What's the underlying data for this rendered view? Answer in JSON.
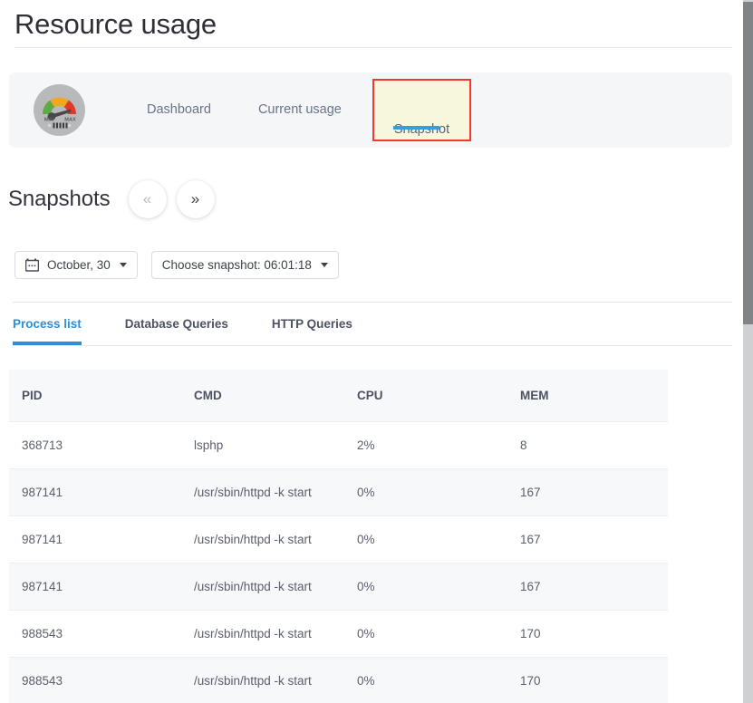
{
  "page": {
    "title": "Resource usage"
  },
  "nav": {
    "logo_icon": "gauge-icon",
    "items": [
      {
        "label": "Dashboard",
        "active": false
      },
      {
        "label": "Current usage",
        "active": false
      },
      {
        "label": "Snapshot",
        "active": true
      }
    ],
    "active_highlight_color": "#f5382c",
    "active_bg_color": "#f7f7de",
    "active_underline_color": "#3c9cd7"
  },
  "snapshots": {
    "heading": "Snapshots",
    "prev_icon": "«",
    "next_icon": "»",
    "date_button": {
      "icon": "calendar-icon",
      "label": "October, 30"
    },
    "snapshot_button": {
      "label": "Choose snapshot: 06:01:18"
    }
  },
  "tabs": [
    {
      "label": "Process list",
      "active": true
    },
    {
      "label": "Database Queries",
      "active": false
    },
    {
      "label": "HTTP Queries",
      "active": false
    }
  ],
  "accent_color": "#2a8fe0",
  "table": {
    "columns": [
      "PID",
      "CMD",
      "CPU",
      "MEM"
    ],
    "rows": [
      [
        "368713",
        "lsphp",
        "2%",
        "8"
      ],
      [
        "987141",
        "/usr/sbin/httpd -k start",
        "0%",
        "167"
      ],
      [
        "987141",
        "/usr/sbin/httpd -k start",
        "0%",
        "167"
      ],
      [
        "987141",
        "/usr/sbin/httpd -k start",
        "0%",
        "167"
      ],
      [
        "988543",
        "/usr/sbin/httpd -k start",
        "0%",
        "170"
      ],
      [
        "988543",
        "/usr/sbin/httpd -k start",
        "0%",
        "170"
      ]
    ]
  }
}
